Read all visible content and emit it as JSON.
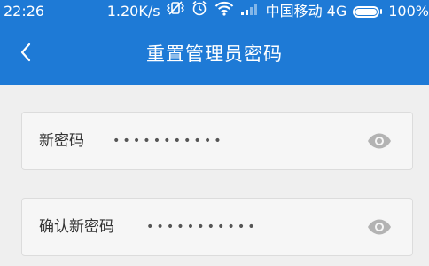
{
  "status_bar": {
    "time": "22:26",
    "speed": "1.20K/s",
    "carrier": "中国移动 4G",
    "battery": "100%",
    "battery_level": 1.0
  },
  "nav": {
    "title": "重置管理员密码"
  },
  "fields": [
    {
      "label": "新密码",
      "value": "•••••••••••"
    },
    {
      "label": "确认新密码",
      "value": "•••••••••••"
    }
  ],
  "colors": {
    "header_bg": "#1e7ad6",
    "page_bg": "#efefef",
    "field_bg": "#f6f6f6",
    "eye_icon": "#b3b3b3"
  },
  "icons": {
    "back": "chevron-left-icon",
    "vibrate_off": "vibrate-off-icon",
    "alarm": "alarm-icon",
    "wifi": "wifi-icon",
    "signal": "signal-icon",
    "battery": "battery-icon",
    "eye": "eye-icon"
  }
}
